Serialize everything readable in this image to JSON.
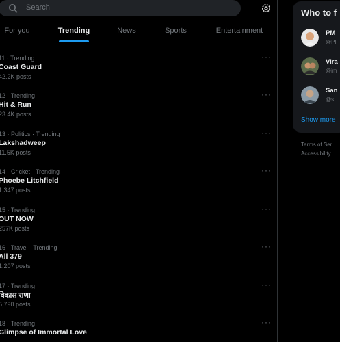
{
  "search": {
    "placeholder": "Search"
  },
  "tabs": [
    {
      "label": "For you"
    },
    {
      "label": "Trending"
    },
    {
      "label": "News"
    },
    {
      "label": "Sports"
    },
    {
      "label": "Entertainment"
    }
  ],
  "trends": [
    {
      "meta": "11 · Trending",
      "name": "Coast Guard",
      "count": "42.2K posts"
    },
    {
      "meta": "12 · Trending",
      "name": "Hit & Run",
      "count": "23.4K posts"
    },
    {
      "meta": "13 · Politics · Trending",
      "name": "Lakshadweep",
      "count": "11.5K posts"
    },
    {
      "meta": "14 · Cricket · Trending",
      "name": "Phoebe Litchfield",
      "count": "1,347 posts"
    },
    {
      "meta": "15 · Trending",
      "name": "OUT NOW",
      "count": "257K posts"
    },
    {
      "meta": "16 · Travel · Trending",
      "name": "All 379",
      "count": "1,207 posts"
    },
    {
      "meta": "17 · Trending",
      "name": "विकास राणा",
      "count": "5,790 posts"
    },
    {
      "meta": "18 · Trending",
      "name": "Glimpse of Immortal Love",
      "count": ""
    }
  ],
  "sidebar": {
    "title": "Who to f",
    "who": [
      {
        "name": "PM",
        "handle": "@PI"
      },
      {
        "name": "Vira",
        "handle": "@im"
      },
      {
        "name": "San",
        "handle": "@s"
      }
    ],
    "show_more": "Show more"
  },
  "footer": {
    "terms": "Terms of Ser",
    "accessibility": "Accessibility"
  },
  "colors": {
    "accent": "#1d9bf0",
    "background": "#000000",
    "card": "#16181c",
    "muted": "#71767b"
  },
  "icons": {
    "search": "search-icon",
    "settings": "gear-icon",
    "more": "more-icon"
  }
}
